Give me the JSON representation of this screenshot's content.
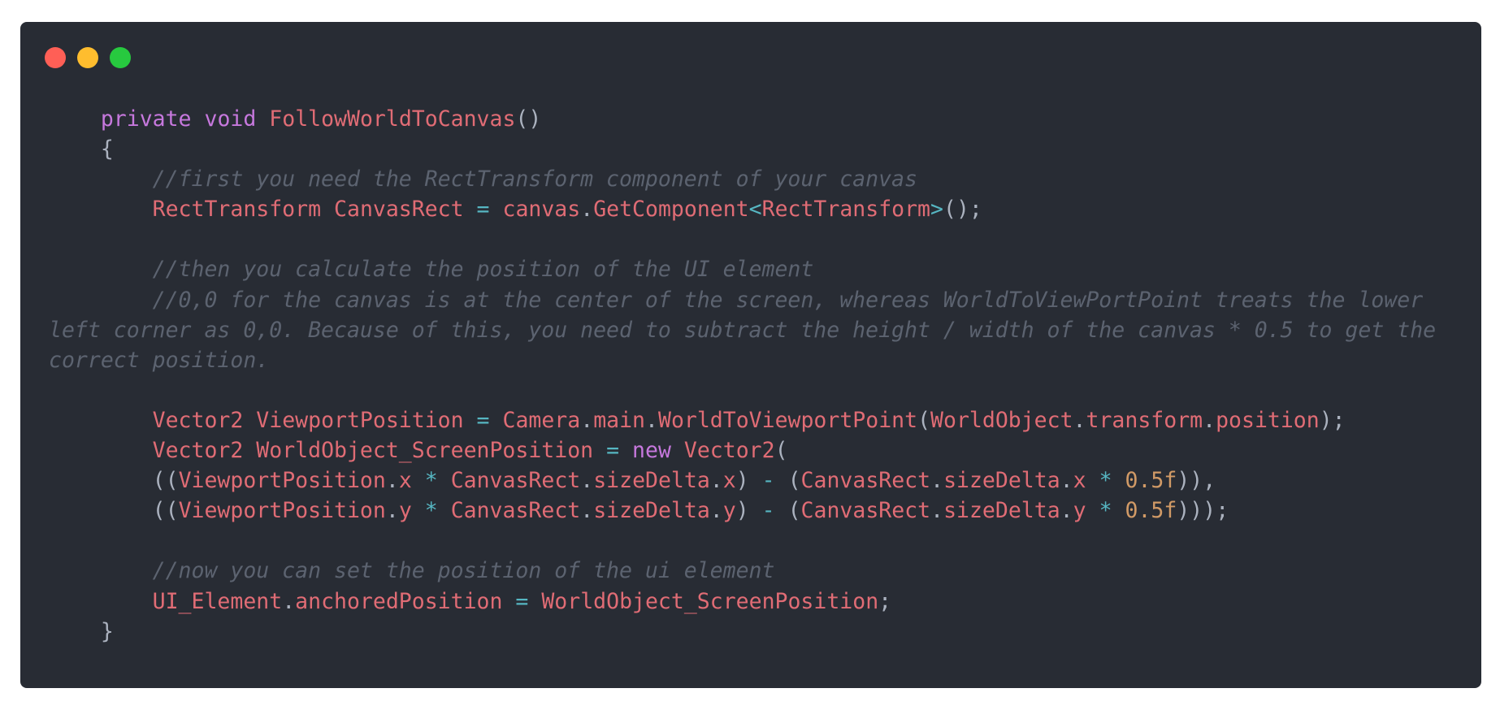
{
  "window": {
    "controls": [
      {
        "name": "close",
        "color": "#ff5f56"
      },
      {
        "name": "minimize",
        "color": "#ffbd2e"
      },
      {
        "name": "maximize",
        "color": "#27c93f"
      }
    ]
  },
  "colors": {
    "background": "#282c34",
    "keyword": "#c678dd",
    "identifier": "#e06c75",
    "operator": "#56b6c2",
    "number": "#d19a66",
    "comment": "#5c6370",
    "punctuation": "#abb2bf"
  },
  "code": {
    "lines": [
      [
        {
          "t": "    ",
          "k": "p"
        },
        {
          "t": "private",
          "k": "kw"
        },
        {
          "t": " ",
          "k": "p"
        },
        {
          "t": "void",
          "k": "kw"
        },
        {
          "t": " ",
          "k": "p"
        },
        {
          "t": "FollowWorldToCanvas",
          "k": "id"
        },
        {
          "t": "()",
          "k": "p"
        }
      ],
      [
        {
          "t": "    {",
          "k": "p"
        }
      ],
      [
        {
          "t": "        ",
          "k": "p"
        },
        {
          "t": "//first you need the RectTransform component of your canvas",
          "k": "cm"
        }
      ],
      [
        {
          "t": "        ",
          "k": "p"
        },
        {
          "t": "RectTransform",
          "k": "id"
        },
        {
          "t": " ",
          "k": "p"
        },
        {
          "t": "CanvasRect",
          "k": "id"
        },
        {
          "t": " ",
          "k": "p"
        },
        {
          "t": "=",
          "k": "op"
        },
        {
          "t": " ",
          "k": "p"
        },
        {
          "t": "canvas",
          "k": "id"
        },
        {
          "t": ".",
          "k": "p"
        },
        {
          "t": "GetComponent",
          "k": "id"
        },
        {
          "t": "<",
          "k": "op"
        },
        {
          "t": "RectTransform",
          "k": "id"
        },
        {
          "t": ">",
          "k": "op"
        },
        {
          "t": "();",
          "k": "p"
        }
      ],
      [],
      [
        {
          "t": "        ",
          "k": "p"
        },
        {
          "t": "//then you calculate the position of the UI element",
          "k": "cm"
        }
      ],
      [
        {
          "t": "        ",
          "k": "p"
        },
        {
          "t": "//0,0 for the canvas is at the center of the screen, whereas WorldToViewPortPoint treats the lower left corner as 0,0. Because of this, you need to subtract the height / width of the canvas * 0.5 to get the correct position.",
          "k": "cm"
        }
      ],
      [],
      [
        {
          "t": "        ",
          "k": "p"
        },
        {
          "t": "Vector2",
          "k": "id"
        },
        {
          "t": " ",
          "k": "p"
        },
        {
          "t": "ViewportPosition",
          "k": "id"
        },
        {
          "t": " ",
          "k": "p"
        },
        {
          "t": "=",
          "k": "op"
        },
        {
          "t": " ",
          "k": "p"
        },
        {
          "t": "Camera",
          "k": "id"
        },
        {
          "t": ".",
          "k": "p"
        },
        {
          "t": "main",
          "k": "id"
        },
        {
          "t": ".",
          "k": "p"
        },
        {
          "t": "WorldToViewportPoint",
          "k": "id"
        },
        {
          "t": "(",
          "k": "p"
        },
        {
          "t": "WorldObject",
          "k": "id"
        },
        {
          "t": ".",
          "k": "p"
        },
        {
          "t": "transform",
          "k": "id"
        },
        {
          "t": ".",
          "k": "p"
        },
        {
          "t": "position",
          "k": "id"
        },
        {
          "t": ");",
          "k": "p"
        }
      ],
      [
        {
          "t": "        ",
          "k": "p"
        },
        {
          "t": "Vector2",
          "k": "id"
        },
        {
          "t": " ",
          "k": "p"
        },
        {
          "t": "WorldObject_ScreenPosition",
          "k": "id"
        },
        {
          "t": " ",
          "k": "p"
        },
        {
          "t": "=",
          "k": "op"
        },
        {
          "t": " ",
          "k": "p"
        },
        {
          "t": "new",
          "k": "kw"
        },
        {
          "t": " ",
          "k": "p"
        },
        {
          "t": "Vector2",
          "k": "id"
        },
        {
          "t": "(",
          "k": "p"
        }
      ],
      [
        {
          "t": "        ((",
          "k": "p"
        },
        {
          "t": "ViewportPosition",
          "k": "id"
        },
        {
          "t": ".",
          "k": "p"
        },
        {
          "t": "x",
          "k": "id"
        },
        {
          "t": " ",
          "k": "p"
        },
        {
          "t": "*",
          "k": "op"
        },
        {
          "t": " ",
          "k": "p"
        },
        {
          "t": "CanvasRect",
          "k": "id"
        },
        {
          "t": ".",
          "k": "p"
        },
        {
          "t": "sizeDelta",
          "k": "id"
        },
        {
          "t": ".",
          "k": "p"
        },
        {
          "t": "x",
          "k": "id"
        },
        {
          "t": ") ",
          "k": "p"
        },
        {
          "t": "-",
          "k": "op"
        },
        {
          "t": " (",
          "k": "p"
        },
        {
          "t": "CanvasRect",
          "k": "id"
        },
        {
          "t": ".",
          "k": "p"
        },
        {
          "t": "sizeDelta",
          "k": "id"
        },
        {
          "t": ".",
          "k": "p"
        },
        {
          "t": "x",
          "k": "id"
        },
        {
          "t": " ",
          "k": "p"
        },
        {
          "t": "*",
          "k": "op"
        },
        {
          "t": " ",
          "k": "p"
        },
        {
          "t": "0.5f",
          "k": "num"
        },
        {
          "t": ")),",
          "k": "p"
        }
      ],
      [
        {
          "t": "        ((",
          "k": "p"
        },
        {
          "t": "ViewportPosition",
          "k": "id"
        },
        {
          "t": ".",
          "k": "p"
        },
        {
          "t": "y",
          "k": "id"
        },
        {
          "t": " ",
          "k": "p"
        },
        {
          "t": "*",
          "k": "op"
        },
        {
          "t": " ",
          "k": "p"
        },
        {
          "t": "CanvasRect",
          "k": "id"
        },
        {
          "t": ".",
          "k": "p"
        },
        {
          "t": "sizeDelta",
          "k": "id"
        },
        {
          "t": ".",
          "k": "p"
        },
        {
          "t": "y",
          "k": "id"
        },
        {
          "t": ") ",
          "k": "p"
        },
        {
          "t": "-",
          "k": "op"
        },
        {
          "t": " (",
          "k": "p"
        },
        {
          "t": "CanvasRect",
          "k": "id"
        },
        {
          "t": ".",
          "k": "p"
        },
        {
          "t": "sizeDelta",
          "k": "id"
        },
        {
          "t": ".",
          "k": "p"
        },
        {
          "t": "y",
          "k": "id"
        },
        {
          "t": " ",
          "k": "p"
        },
        {
          "t": "*",
          "k": "op"
        },
        {
          "t": " ",
          "k": "p"
        },
        {
          "t": "0.5f",
          "k": "num"
        },
        {
          "t": ")));",
          "k": "p"
        }
      ],
      [],
      [
        {
          "t": "        ",
          "k": "p"
        },
        {
          "t": "//now you can set the position of the ui element",
          "k": "cm"
        }
      ],
      [
        {
          "t": "        ",
          "k": "p"
        },
        {
          "t": "UI_Element",
          "k": "id"
        },
        {
          "t": ".",
          "k": "p"
        },
        {
          "t": "anchoredPosition",
          "k": "id"
        },
        {
          "t": " ",
          "k": "p"
        },
        {
          "t": "=",
          "k": "op"
        },
        {
          "t": " ",
          "k": "p"
        },
        {
          "t": "WorldObject_ScreenPosition",
          "k": "id"
        },
        {
          "t": ";",
          "k": "p"
        }
      ],
      [
        {
          "t": "    }",
          "k": "p"
        }
      ]
    ]
  }
}
